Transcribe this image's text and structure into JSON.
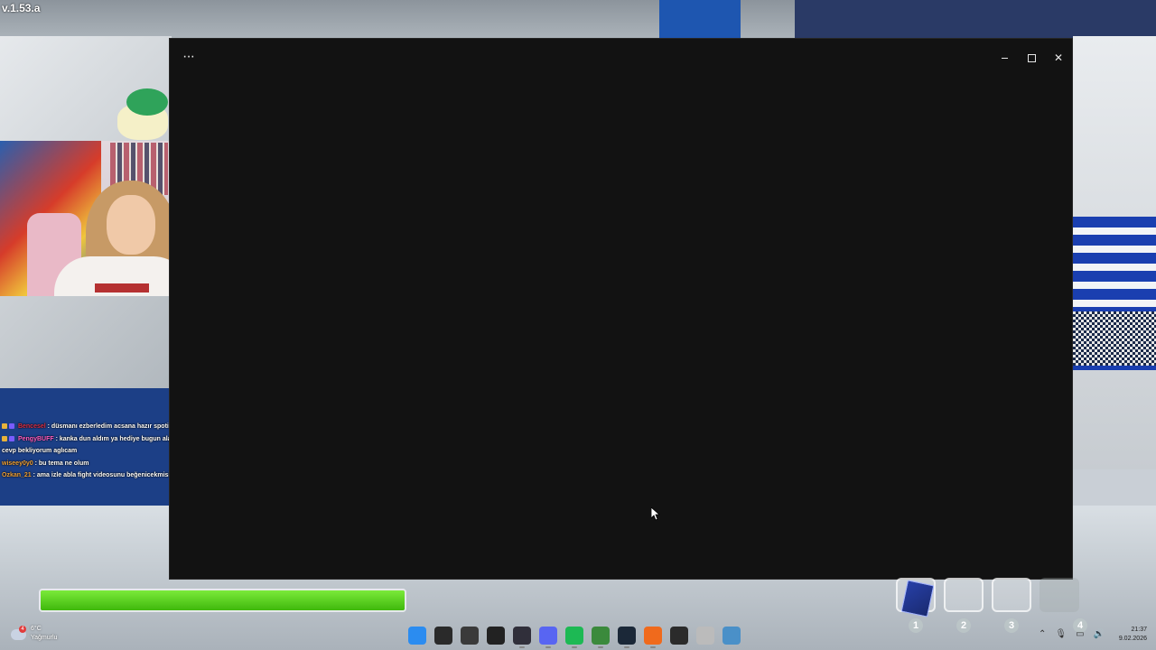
{
  "game": {
    "version": "v.1.53.a",
    "health_percent": 100
  },
  "chat": {
    "messages": [
      {
        "user": "Bencesel",
        "text": ": düsmanı ezberledim acsana hazır spotideyken"
      },
      {
        "user": "PengyBUFF",
        "text": ": kanka dun aldım ya hediye bugun alamıyorum steam destekten cevp bekliyorum aglıcam"
      },
      {
        "user": "wiseey0y0",
        "text": ": bu tema ne olum"
      },
      {
        "user": "Ozkan_21",
        "text": ": ama izle abla fight videosunu beğenicekmisin"
      }
    ]
  },
  "window": {
    "menu_label": "···",
    "minimize_icon": "minimize-icon",
    "maximize_icon": "maximize-icon",
    "close_label": "✕"
  },
  "hotbar": {
    "slots": [
      "1",
      "2",
      "3",
      "4"
    ]
  },
  "taskbar": {
    "weather": {
      "badge": "4",
      "temp": "6°C",
      "condition": "Yağmurlu"
    },
    "apps": [
      {
        "name": "windows-start",
        "color": "#2b8cf0"
      },
      {
        "name": "search",
        "color": "#2a2a2a"
      },
      {
        "name": "task-view",
        "color": "#3a3a3a"
      },
      {
        "name": "steelseries",
        "color": "#222222"
      },
      {
        "name": "obs",
        "color": "#302f3a"
      },
      {
        "name": "discord",
        "color": "#5865f2"
      },
      {
        "name": "spotify",
        "color": "#1db954"
      },
      {
        "name": "chrome",
        "color": "#3b8a3c"
      },
      {
        "name": "steam",
        "color": "#1b2838"
      },
      {
        "name": "aimp",
        "color": "#f06a1c"
      },
      {
        "name": "twitch-studio",
        "color": "#2b2b2b"
      },
      {
        "name": "clock-app",
        "color": "#bbbbbb"
      },
      {
        "name": "game",
        "color": "#4a90c8"
      }
    ],
    "time": "21:37",
    "date": "9.02.2026"
  },
  "colors": {
    "window_bg": "#121212",
    "health_green": "#5fd11e"
  }
}
